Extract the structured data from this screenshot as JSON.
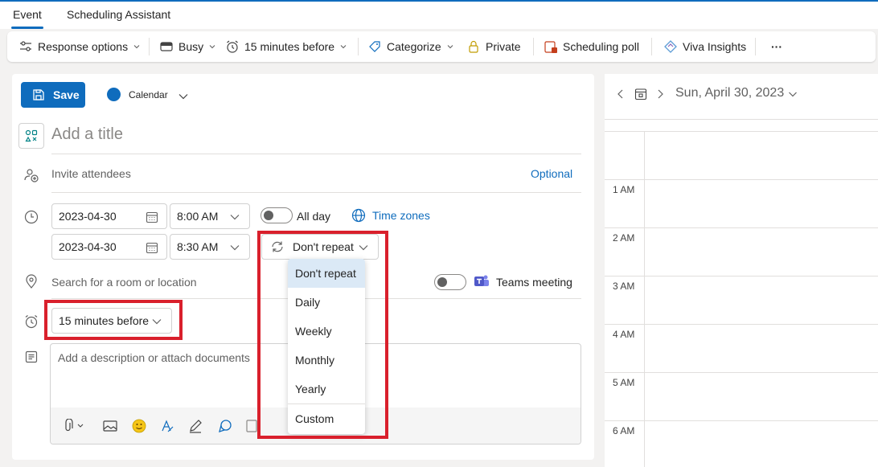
{
  "tabs": [
    {
      "label": "Event",
      "active": true
    },
    {
      "label": "Scheduling Assistant",
      "active": false
    }
  ],
  "ribbon": {
    "response_options": "Response options",
    "busy": "Busy",
    "reminder": "15 minutes before",
    "categorize": "Categorize",
    "private": "Private",
    "scheduling_poll": "Scheduling poll",
    "viva_insights": "Viva Insights",
    "more": "···"
  },
  "form": {
    "save_label": "Save",
    "calendar_label": "Calendar",
    "calendar_color": "#0f6cbd",
    "title_placeholder": "Add a title",
    "attendees_placeholder": "Invite attendees",
    "optional_label": "Optional",
    "start_date": "2023-04-30",
    "start_time": "8:00 AM",
    "end_date": "2023-04-30",
    "end_time": "8:30 AM",
    "all_day_label": "All day",
    "all_day_on": false,
    "time_zones_label": "Time zones",
    "repeat_value": "Don't repeat",
    "location_placeholder": "Search for a room or location",
    "teams_meeting_label": "Teams meeting",
    "teams_meeting_on": false,
    "reminder_value": "15 minutes before",
    "description_placeholder": "Add a description or attach documents"
  },
  "repeat_menu": {
    "options": [
      "Don't repeat",
      "Daily",
      "Weekly",
      "Monthly",
      "Yearly",
      "Custom"
    ],
    "selected": "Don't repeat"
  },
  "calendar": {
    "date_label": "Sun, April 30, 2023",
    "hours": [
      "1 AM",
      "2 AM",
      "3 AM",
      "4 AM",
      "5 AM",
      "6 AM"
    ]
  },
  "colors": {
    "accent": "#0f6cbd",
    "highlight_box": "#d9202c",
    "selected_item": "#dbe9f6"
  },
  "icons": {
    "response_options": "sliders-icon",
    "busy": "status-icon",
    "reminder": "alarm-clock-icon",
    "categorize": "tag-icon",
    "private": "lock-icon",
    "scheduling_poll": "poll-icon",
    "viva_insights": "viva-icon"
  }
}
